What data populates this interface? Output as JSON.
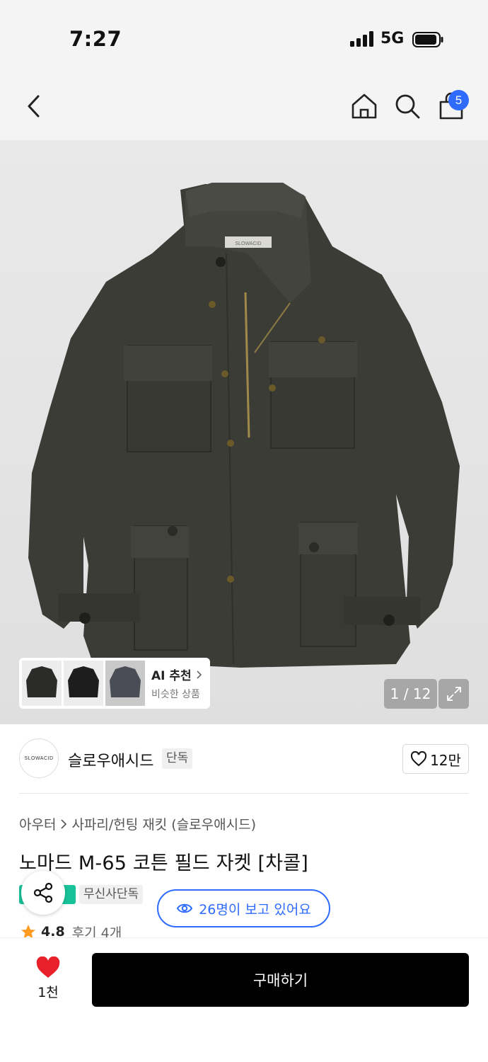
{
  "status_bar": {
    "time": "7:27",
    "network": "5G"
  },
  "header": {
    "cart_count": "5"
  },
  "gallery": {
    "label_text": "SLOWACID",
    "ai_recommend": {
      "title": "AI 추천",
      "subtitle": "비슷한 상품"
    },
    "counter": "1 / 12"
  },
  "brand": {
    "logo_text": "SLOWACID",
    "name": "슬로우애시드",
    "tag": "단독",
    "likes": "12만"
  },
  "breadcrumb": {
    "category": "아우터",
    "subcategory": "사파리/헌팅 재킷 (슬로우애시드)"
  },
  "product": {
    "title": "노마드 M-65 코튼 필드 자켓 [차콜]",
    "exclusive_badge": "무신사단독",
    "viewers": "26명이 보고 있어요",
    "rating": "4.8",
    "reviews": "후기 4개"
  },
  "bottom_bar": {
    "like_count": "1천",
    "buy_label": "구매하기"
  },
  "colors": {
    "accent": "#2f6bff",
    "heart": "#e8202a",
    "badge_green": "#19c39a",
    "jacket": "#3b3c36"
  }
}
